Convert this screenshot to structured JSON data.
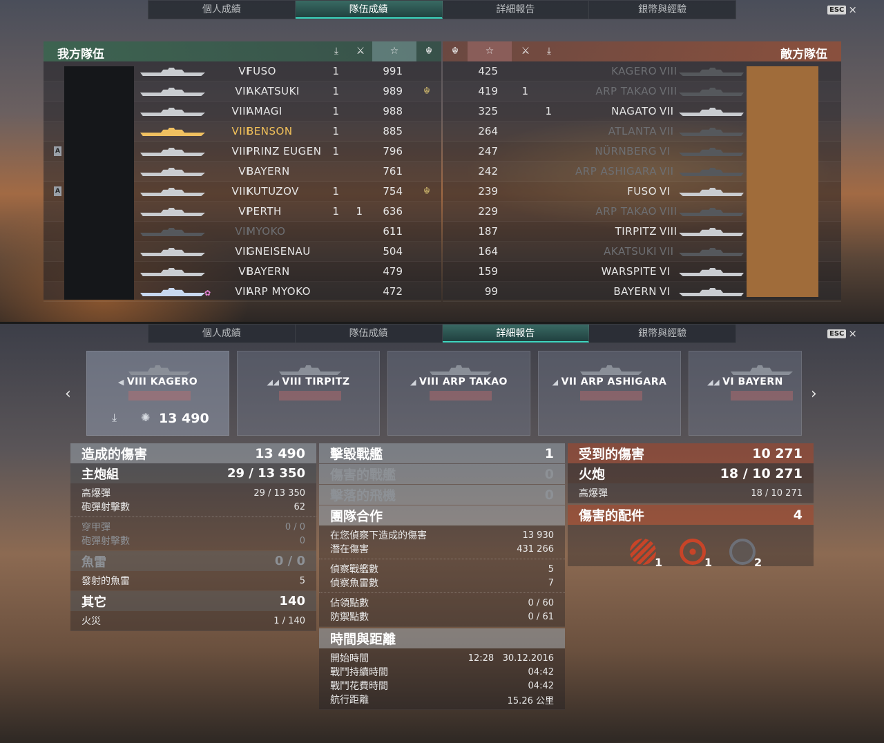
{
  "tabs": [
    "個人成績",
    "隊伍成績",
    "詳細報告",
    "銀幣與經驗"
  ],
  "esc": {
    "key": "ESC",
    "close": "×"
  },
  "team": {
    "ally_title": "我方隊伍",
    "enemy_title": "敵方隊伍",
    "header_icons": {
      "torpedo": "⤓",
      "swords": "⚔",
      "star": "☆",
      "wreath": "☬"
    },
    "ally_rows": [
      {
        "tier": "VI",
        "name": "FUSO",
        "kills": "1",
        "kills2": "",
        "score": "991",
        "award": "",
        "style": "",
        "badge": ""
      },
      {
        "tier": "VII",
        "name": "AKATSUKI",
        "kills": "1",
        "kills2": "",
        "score": "989",
        "award": "☬",
        "style": "",
        "badge": ""
      },
      {
        "tier": "VIII",
        "name": "AMAGI",
        "kills": "1",
        "kills2": "",
        "score": "988",
        "award": "",
        "style": "",
        "badge": ""
      },
      {
        "tier": "VIII",
        "name": "BENSON",
        "kills": "1",
        "kills2": "",
        "score": "885",
        "award": "",
        "style": "gold",
        "badge": ""
      },
      {
        "tier": "VIII",
        "name": "PRINZ EUGEN",
        "kills": "1",
        "kills2": "",
        "score": "796",
        "award": "",
        "style": "",
        "badge": "A"
      },
      {
        "tier": "VI",
        "name": "BAYERN",
        "kills": "",
        "kills2": "",
        "score": "761",
        "award": "",
        "style": "",
        "badge": ""
      },
      {
        "tier": "VIII",
        "name": "KUTUZOV",
        "kills": "1",
        "kills2": "",
        "score": "754",
        "award": "☬",
        "style": "",
        "badge": "A"
      },
      {
        "tier": "VI",
        "name": "PERTH",
        "kills": "1",
        "kills2": "1",
        "score": "636",
        "award": "",
        "style": "",
        "badge": ""
      },
      {
        "tier": "VII",
        "name": "MYOKO",
        "kills": "",
        "kills2": "",
        "score": "611",
        "award": "",
        "style": "dim",
        "badge": ""
      },
      {
        "tier": "VII",
        "name": "GNEISENAU",
        "kills": "",
        "kills2": "",
        "score": "504",
        "award": "",
        "style": "",
        "badge": ""
      },
      {
        "tier": "VI",
        "name": "BAYERN",
        "kills": "",
        "kills2": "",
        "score": "479",
        "award": "",
        "style": "",
        "badge": ""
      },
      {
        "tier": "VII",
        "name": "ARP MYOKO",
        "kills": "",
        "kills2": "",
        "score": "472",
        "award": "",
        "style": "lblue",
        "badge": ""
      }
    ],
    "enemy_rows": [
      {
        "score": "425",
        "kills2": "",
        "kills": "",
        "name": "KAGERO",
        "tier": "VIII",
        "style": "dim"
      },
      {
        "score": "419",
        "kills2": "1",
        "kills": "",
        "name": "ARP TAKAO",
        "tier": "VIII",
        "style": "dim"
      },
      {
        "score": "325",
        "kills2": "",
        "kills": "1",
        "name": "NAGATO",
        "tier": "VII",
        "style": ""
      },
      {
        "score": "264",
        "kills2": "",
        "kills": "",
        "name": "ATLANTA",
        "tier": "VII",
        "style": "dim"
      },
      {
        "score": "247",
        "kills2": "",
        "kills": "",
        "name": "NÜRNBERG",
        "tier": "VI",
        "style": "dim"
      },
      {
        "score": "242",
        "kills2": "",
        "kills": "",
        "name": "ARP ASHIGARA",
        "tier": "VII",
        "style": "dim"
      },
      {
        "score": "239",
        "kills2": "",
        "kills": "",
        "name": "FUSO",
        "tier": "VI",
        "style": ""
      },
      {
        "score": "229",
        "kills2": "",
        "kills": "",
        "name": "ARP TAKAO",
        "tier": "VIII",
        "style": "dim"
      },
      {
        "score": "187",
        "kills2": "",
        "kills": "",
        "name": "TIRPITZ",
        "tier": "VIII",
        "style": ""
      },
      {
        "score": "164",
        "kills2": "",
        "kills": "",
        "name": "AKATSUKI",
        "tier": "VII",
        "style": "dim"
      },
      {
        "score": "159",
        "kills2": "",
        "kills": "",
        "name": "WARSPITE",
        "tier": "VI",
        "style": ""
      },
      {
        "score": "99",
        "kills2": "",
        "kills": "",
        "name": "BAYERN",
        "tier": "VI",
        "style": ""
      }
    ]
  },
  "cards": [
    {
      "tier": "VIII",
      "name": "KAGERO",
      "class_icon": "◀",
      "damage": "13 490",
      "active": true
    },
    {
      "tier": "VIII",
      "name": "TIRPITZ",
      "class_icon": "◢◢",
      "damage": "",
      "active": false
    },
    {
      "tier": "VIII",
      "name": "ARP TAKAO",
      "class_icon": "◢",
      "damage": "",
      "active": false
    },
    {
      "tier": "VII",
      "name": "ARP ASHIGARA",
      "class_icon": "◢",
      "damage": "",
      "active": false
    },
    {
      "tier": "VI",
      "name": "BAYERN",
      "class_icon": "◢◢",
      "damage": "",
      "active": false
    }
  ],
  "nav": {
    "prev": "‹",
    "next": "›"
  },
  "dealt": {
    "title": "造成的傷害",
    "total": "13 490",
    "main": {
      "label": "主炮組",
      "value": "29 / 13 350"
    },
    "he": {
      "label": "高爆彈",
      "value": "29 / 13 350",
      "shots_label": "砲彈射擊數",
      "shots": "62"
    },
    "ap": {
      "label": "穿甲彈",
      "value": "0 / 0",
      "shots_label": "砲彈射擊數",
      "shots": "0"
    },
    "torp": {
      "label": "魚雷",
      "value": "0 / 0",
      "fired_label": "發射的魚雷",
      "fired": "5"
    },
    "other": {
      "label": "其它",
      "value": "140",
      "fire_label": "火災",
      "fire": "1 / 140"
    }
  },
  "mid": {
    "destroyed": {
      "label": "擊毀戰艦",
      "value": "1"
    },
    "damaged": {
      "label": "傷害的戰艦",
      "value": "0"
    },
    "planes": {
      "label": "擊落的飛機",
      "value": "0"
    },
    "team": {
      "label": "團隊合作",
      "spot_dmg_label": "在您偵察下造成的傷害",
      "spot_dmg": "13 930",
      "potential_label": "潛在傷害",
      "potential": "431 266",
      "spot_ships_label": "偵察戰艦數",
      "spot_ships": "5",
      "spot_torps_label": "偵察魚雷數",
      "spot_torps": "7",
      "cap_label": "佔領點數",
      "cap": "0 / 60",
      "def_label": "防禦點數",
      "def": "0 / 61"
    },
    "time": {
      "label": "時間與距離",
      "start_label": "開始時間",
      "start": "12:28   30.12.2016",
      "duration_label": "戰鬥持續時間",
      "duration": "04:42",
      "spent_label": "戰鬥花費時間",
      "spent": "04:42",
      "distance_label": "航行距離",
      "distance": "15.26 公里"
    }
  },
  "received": {
    "title": "受到的傷害",
    "total": "10 271",
    "fire": {
      "label": "火炮",
      "value": "18 / 10 271"
    },
    "he": {
      "label": "高爆彈",
      "value": "18 / 10 271"
    },
    "modules": {
      "label": "傷害的配件",
      "value": "4",
      "items": [
        {
          "name": "torpedo-tubes",
          "count": "1"
        },
        {
          "name": "steering-gear",
          "count": "1"
        },
        {
          "name": "engine",
          "count": "2"
        }
      ]
    }
  },
  "colors": {
    "accent": "#3dd6c0",
    "gold": "#f2c15a",
    "enemy_avatar": "#a06c3a"
  }
}
